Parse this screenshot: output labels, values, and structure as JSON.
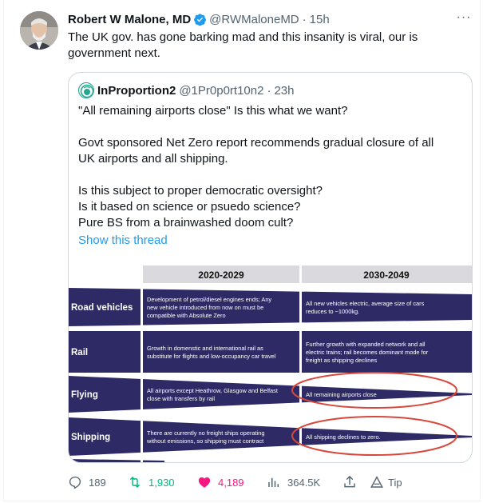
{
  "author": {
    "name": "Robert W Malone, MD",
    "handle": "@RWMaloneMD",
    "separator": "·",
    "time": "15h",
    "more_label": "···"
  },
  "tweet": {
    "text": "The UK gov. has gone barking mad and this insanity is viral, our is government next."
  },
  "quote": {
    "name": "InProportion2",
    "handle": "@1Pr0p0rt10n2",
    "separator": "·",
    "time": "23h",
    "line1": "\"All remaining airports close\" Is this what we want?",
    "line2": "Govt sponsored Net Zero report recommends gradual closure of all UK airports and all shipping.",
    "line3": "Is this subject to proper democratic oversight?",
    "line4": "Is it based on science or psuedo science?",
    "line5": "Pure BS from a brainwashed doom cult?",
    "show_thread": "Show this thread"
  },
  "table_image": {
    "col1_header": "2020-2029",
    "col2_header": "2030-2049",
    "rows": [
      {
        "label": "Road vehicles",
        "col1": [
          "Development of petrol/diesel engines ends; Any",
          "new vehicle introduced from now on must be",
          "compatible with Absolute Zero"
        ],
        "col2": [
          "All new vehicles electric, average size of cars",
          "reduces to ~1000kg."
        ]
      },
      {
        "label": "Rail",
        "col1": [
          "Growth in domenstic and international rail as",
          "substitute for flights and low-occupancy car travel"
        ],
        "col2": [
          "Further growth with expanded network and all",
          "electric trains; rail becomes dominant mode for",
          "freight as shipping declines"
        ]
      },
      {
        "label": "Flying",
        "col1": [
          "All airports except Heathrow, Glasgow and Belfast",
          "close with transfers by rail"
        ],
        "col2": [
          "All remaining airports close"
        ]
      },
      {
        "label": "Shipping",
        "col1": [
          "There are currently no freight ships operating",
          "without emissions, so shipping must contract"
        ],
        "col2": [
          "All shipping declines to zero."
        ]
      }
    ],
    "colors": {
      "band": "#2e2a66",
      "header_bg": "#d9d9de",
      "highlight_circle": "#d9473b"
    }
  },
  "actions": {
    "replies": "189",
    "retweets": "1,930",
    "likes": "4,189",
    "views": "364.5K",
    "tip": "Tip"
  },
  "colors": {
    "link": "#1d9bf0",
    "retweet": "#00ba7c",
    "like": "#f91880",
    "muted": "#536471"
  }
}
